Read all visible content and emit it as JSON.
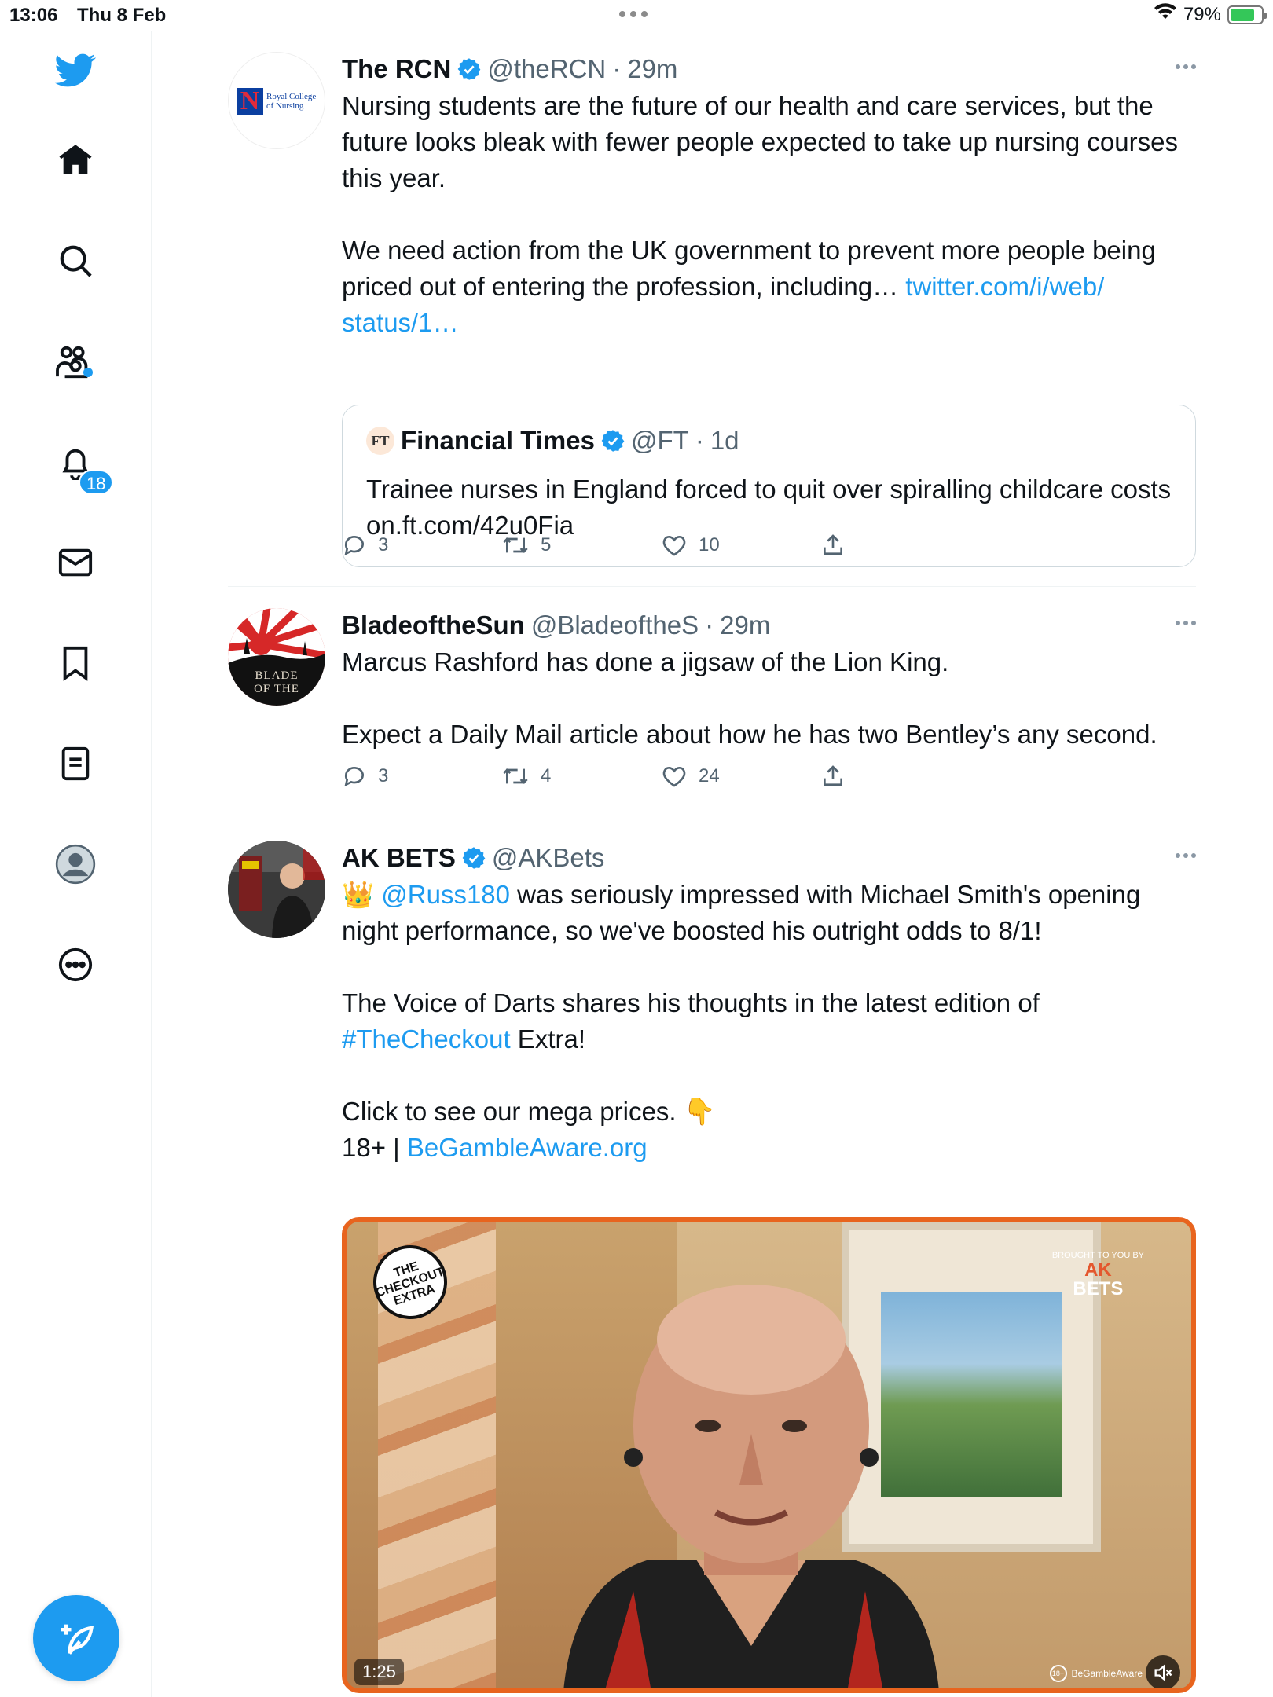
{
  "status_bar": {
    "time": "13:06",
    "date": "Thu 8 Feb",
    "battery": "79%",
    "battery_level": 0.79,
    "icons": [
      "wifi-icon",
      "battery-charging-icon"
    ]
  },
  "sidebar": {
    "items": [
      {
        "name": "twitter-logo-icon"
      },
      {
        "name": "home-icon"
      },
      {
        "name": "search-icon"
      },
      {
        "name": "communities-icon"
      },
      {
        "name": "notifications-icon",
        "badge": "18"
      },
      {
        "name": "messages-icon"
      },
      {
        "name": "bookmarks-icon"
      },
      {
        "name": "lists-icon"
      },
      {
        "name": "profile-icon"
      },
      {
        "name": "more-icon"
      }
    ],
    "compose_icon": "compose-tweet-icon"
  },
  "colors": {
    "accent": "#1d9bf0",
    "text": "#0f1419",
    "secondary": "#536471",
    "border": "#eff3f4",
    "video_border": "#e8641e"
  },
  "tweets": [
    {
      "name": "The RCN",
      "verified": true,
      "handle": "@theRCN",
      "sep": "·",
      "time": "29m",
      "avatar_text": {
        "letter": "N",
        "org": "Royal College\nof Nursing"
      },
      "text": "Nursing students are the future of our health and care services, but the future looks bleak with fewer people expected to take up nursing courses this year.\n\nWe need action from the UK government to prevent more people being priced out of entering the profession, including… ",
      "link": "twitter.com/i/web/\nstatus/1…",
      "quote": {
        "logo": "FT",
        "name": "Financial Times",
        "verified": true,
        "handle": "@FT",
        "sep": "·",
        "time": "1d",
        "text": "Trainee nurses in England forced to quit over spiralling childcare costs on.ft.com/42u0Fia"
      },
      "replies": "3",
      "retweets": "5",
      "likes": "10"
    },
    {
      "name": "BladeoftheSun",
      "verified": false,
      "handle": "@BladeoftheS",
      "sep": "·",
      "time": "29m",
      "avatar_text": "BLADE\nOF THE",
      "text": "Marcus Rashford has done a jigsaw of the Lion King.\n\nExpect a Daily Mail article about how he has two Bentley’s any second.",
      "replies": "3",
      "retweets": "4",
      "likes": "24"
    },
    {
      "name": "AK BETS",
      "verified": true,
      "handle": "@AKBets",
      "sep": "·",
      "emoji_crown": "👑",
      "mention": "@Russ180",
      "text_1": " was seriously impressed with Michael Smith's opening night performance, so we've boosted his outright odds to 8/1!\n\nThe Voice of Darts shares his thoughts in the latest edition of\n",
      "hashtag": "#TheCheckout",
      "text_2": " Extra!\n\nClick to see our mega prices.  ",
      "emoji_point": "👇",
      "text_3": "18+ | ",
      "link": "BeGambleAware.org",
      "video": {
        "logo": "THE CHECKOUT\nEXTRA",
        "brought": "BROUGHT TO YOU BY",
        "brand_1": "AK",
        "brand_2": "BETS",
        "duration": "1:25",
        "gamble_18": "18+",
        "gamble_text": "BeGambleAware",
        "mute_icon": "mute-icon"
      }
    }
  ]
}
